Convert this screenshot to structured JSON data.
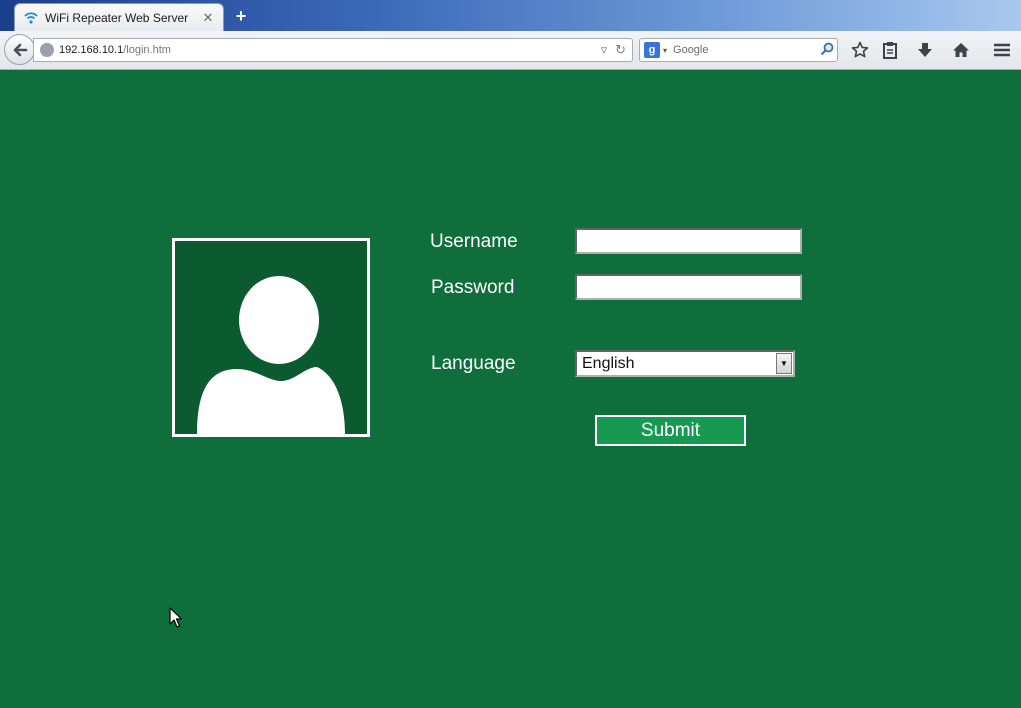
{
  "browser": {
    "tab": {
      "title": "WiFi Repeater Web Server",
      "close_glyph": "✕",
      "favicon": "wifi-icon"
    },
    "new_tab_glyph": "+",
    "url": {
      "host": "192.168.10.1",
      "path": "/login.htm"
    },
    "search": {
      "engine_glyph": "g",
      "placeholder": "Google"
    },
    "toolbar_icons": [
      "star-icon",
      "clipboard-icon",
      "download-icon",
      "home-icon",
      "menu-icon"
    ]
  },
  "login": {
    "username_label": "Username",
    "password_label": "Password",
    "language_label": "Language",
    "username_value": "",
    "password_value": "",
    "language_selected": "English",
    "submit_label": "Submit"
  },
  "colors": {
    "page_background": "#0f6e3b",
    "avatar_background": "#0c5b30",
    "submit_background": "#169a52",
    "text": "#ffffff"
  }
}
